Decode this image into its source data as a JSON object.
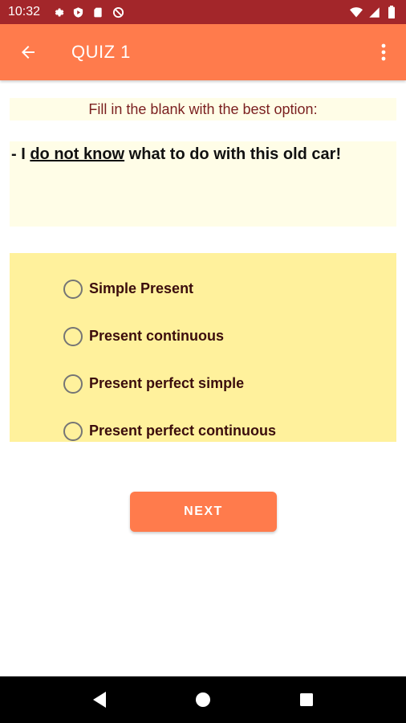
{
  "status_bar": {
    "time": "10:32",
    "icons_left": [
      "settings-icon",
      "shield-play-icon",
      "sd-card-icon",
      "blocked-icon"
    ],
    "icons_right": [
      "wifi-icon",
      "signal-icon",
      "battery-icon"
    ]
  },
  "app_bar": {
    "title": "QUIZ 1",
    "back_icon": "arrow-back-icon",
    "menu_icon": "more-vert-icon",
    "color": "#ff7b4c"
  },
  "quiz": {
    "instruction": "Fill in the blank with the best option:",
    "question": {
      "prefix": "- I ",
      "underlined": "do not know",
      "suffix": " what to do with this old car!"
    },
    "options": [
      {
        "label": "Simple Present",
        "selected": false
      },
      {
        "label": "Present continuous",
        "selected": false
      },
      {
        "label": "Present perfect simple",
        "selected": false
      },
      {
        "label": "Present perfect continuous",
        "selected": false
      }
    ],
    "next_label": "NEXT"
  },
  "nav_bar": {
    "icons": [
      "nav-back-icon",
      "nav-home-icon",
      "nav-recents-icon"
    ]
  },
  "colors": {
    "status_bar": "#a3262a",
    "accent": "#ff7b4c",
    "instruction_bg": "#fffde7",
    "options_bg": "#fff19c",
    "instruction_text": "#7a1f1f",
    "option_text": "#3b0d0d"
  }
}
